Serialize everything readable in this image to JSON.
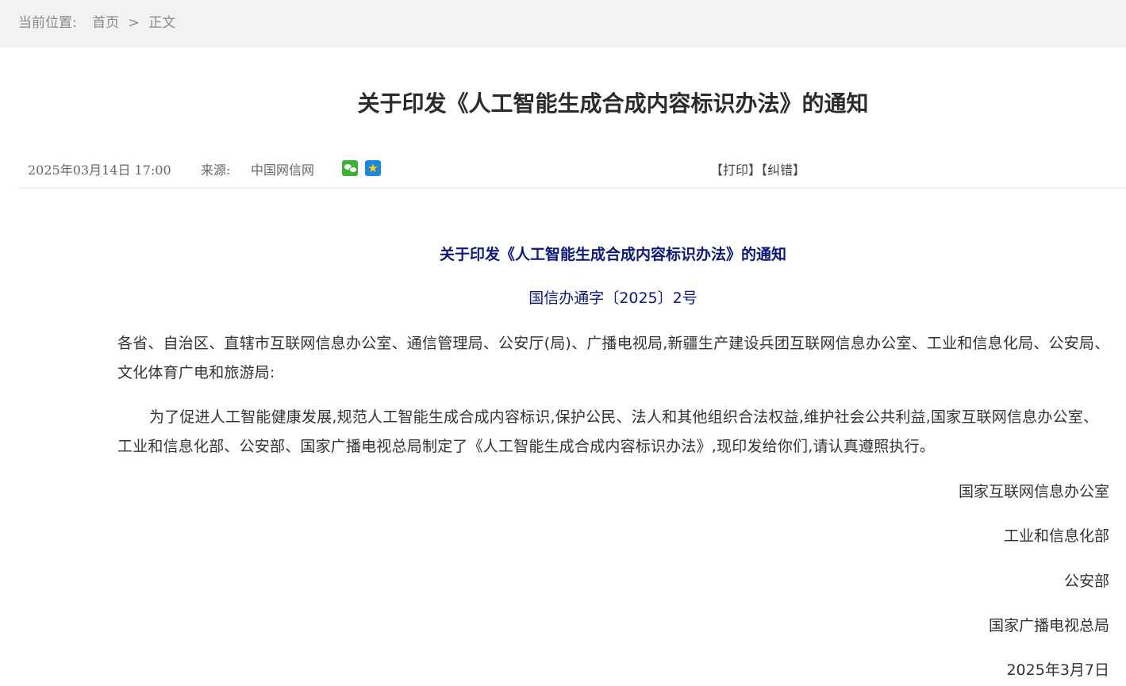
{
  "breadcrumb": {
    "label": "当前位置:",
    "items": [
      "首页",
      "正文"
    ],
    "separator": ">"
  },
  "article": {
    "title": "关于印发《人工智能生成合成内容标识办法》的通知",
    "date": "2025年03月14日 17:00",
    "source_label": "来源:",
    "source_name": "中国网信网",
    "print_label": "【打印】",
    "correction_label": "【纠错】",
    "share_icons": [
      "wechat-icon",
      "qzone-icon"
    ]
  },
  "content": {
    "title": "关于印发《人工智能生成合成内容标识办法》的通知",
    "doc_number": "国信办通字〔2025〕2号",
    "addressees": "各省、自治区、直辖市互联网信息办公室、通信管理局、公安厅(局)、广播电视局,新疆生产建设兵团互联网信息办公室、工业和信息化局、公安局、文化体育广电和旅游局:",
    "body": "为了促进人工智能健康发展,规范人工智能生成合成内容标识,保护公民、法人和其他组织合法权益,维护社会公共利益,国家互联网信息办公室、工业和信息化部、公安部、国家广播电视总局制定了《人工智能生成合成内容标识办法》,现印发给你们,请认真遵照执行。",
    "signatures": [
      "国家互联网信息办公室",
      "工业和信息化部",
      "公安部",
      "国家广播电视总局"
    ],
    "sign_date": "2025年3月7日"
  },
  "colors": {
    "breadcrumb_bg": "#f2f2f2",
    "content_title": "#0b1a7a",
    "wechat": "#3bb234",
    "qzone": "#1e88d8"
  }
}
